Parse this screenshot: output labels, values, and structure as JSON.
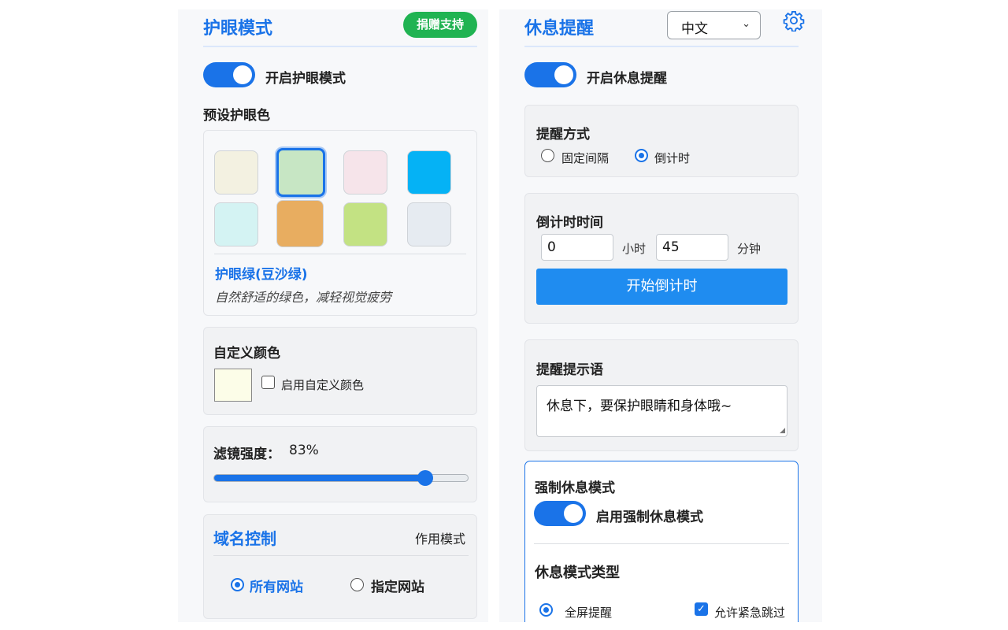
{
  "left": {
    "title": "护眼模式",
    "donate_label": "捐赠支持",
    "toggle_label": "开启护眼模式",
    "preset_heading": "预设护眼色",
    "swatches": [
      {
        "name": "swatch-cream",
        "color": "#f3f1e1",
        "selected": false
      },
      {
        "name": "swatch-bean-green",
        "color": "#c7e6c4",
        "selected": true
      },
      {
        "name": "swatch-pink",
        "color": "#f6e4ea",
        "selected": false
      },
      {
        "name": "swatch-sky-blue",
        "color": "#05b2f5",
        "selected": false
      },
      {
        "name": "swatch-cyan",
        "color": "#d4f3f3",
        "selected": false
      },
      {
        "name": "swatch-orange",
        "color": "#e8ad60",
        "selected": false
      },
      {
        "name": "swatch-lime",
        "color": "#c3e283",
        "selected": false
      },
      {
        "name": "swatch-light-gray",
        "color": "#e6ebf1",
        "selected": false
      }
    ],
    "selected_name": "护眼绿(豆沙绿)",
    "selected_desc": "自然舒适的绿色，减轻视觉疲劳",
    "custom_heading": "自定义颜色",
    "custom_color": "#fcfde8",
    "custom_checkbox_label": "启用自定义颜色",
    "filter_label": "滤镜强度：",
    "filter_value": "83%",
    "filter_level": 0.83,
    "domain_title": "域名控制",
    "domain_mode_label": "作用模式",
    "domain_all": "所有网站",
    "domain_specific": "指定网站"
  },
  "right": {
    "title": "休息提醒",
    "language": "中文",
    "toggle_label": "开启休息提醒",
    "method_heading": "提醒方式",
    "method_fixed": "固定间隔",
    "method_countdown": "倒计时",
    "countdown_heading": "倒计时时间",
    "hours_value": "0",
    "hours_unit": "小时",
    "minutes_value": "45",
    "minutes_unit": "分钟",
    "start_button": "开始倒计时",
    "message_heading": "提醒提示语",
    "message_value": "休息下，要保护眼睛和身体哦~",
    "force_heading": "强制休息模式",
    "force_toggle_label": "启用强制休息模式",
    "rest_type_heading": "休息模式类型",
    "rest_fullscreen": "全屏提醒",
    "allow_skip": "允许紧急跳过"
  }
}
